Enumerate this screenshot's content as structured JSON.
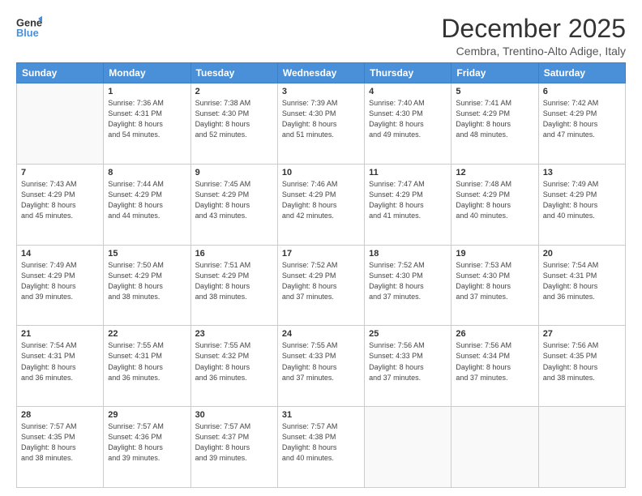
{
  "logo": {
    "line1": "General",
    "line2": "Blue"
  },
  "title": "December 2025",
  "location": "Cembra, Trentino-Alto Adige, Italy",
  "header": {
    "days": [
      "Sunday",
      "Monday",
      "Tuesday",
      "Wednesday",
      "Thursday",
      "Friday",
      "Saturday"
    ]
  },
  "weeks": [
    [
      {
        "day": "",
        "info": ""
      },
      {
        "day": "1",
        "info": "Sunrise: 7:36 AM\nSunset: 4:31 PM\nDaylight: 8 hours\nand 54 minutes."
      },
      {
        "day": "2",
        "info": "Sunrise: 7:38 AM\nSunset: 4:30 PM\nDaylight: 8 hours\nand 52 minutes."
      },
      {
        "day": "3",
        "info": "Sunrise: 7:39 AM\nSunset: 4:30 PM\nDaylight: 8 hours\nand 51 minutes."
      },
      {
        "day": "4",
        "info": "Sunrise: 7:40 AM\nSunset: 4:30 PM\nDaylight: 8 hours\nand 49 minutes."
      },
      {
        "day": "5",
        "info": "Sunrise: 7:41 AM\nSunset: 4:29 PM\nDaylight: 8 hours\nand 48 minutes."
      },
      {
        "day": "6",
        "info": "Sunrise: 7:42 AM\nSunset: 4:29 PM\nDaylight: 8 hours\nand 47 minutes."
      }
    ],
    [
      {
        "day": "7",
        "info": "Sunrise: 7:43 AM\nSunset: 4:29 PM\nDaylight: 8 hours\nand 45 minutes."
      },
      {
        "day": "8",
        "info": "Sunrise: 7:44 AM\nSunset: 4:29 PM\nDaylight: 8 hours\nand 44 minutes."
      },
      {
        "day": "9",
        "info": "Sunrise: 7:45 AM\nSunset: 4:29 PM\nDaylight: 8 hours\nand 43 minutes."
      },
      {
        "day": "10",
        "info": "Sunrise: 7:46 AM\nSunset: 4:29 PM\nDaylight: 8 hours\nand 42 minutes."
      },
      {
        "day": "11",
        "info": "Sunrise: 7:47 AM\nSunset: 4:29 PM\nDaylight: 8 hours\nand 41 minutes."
      },
      {
        "day": "12",
        "info": "Sunrise: 7:48 AM\nSunset: 4:29 PM\nDaylight: 8 hours\nand 40 minutes."
      },
      {
        "day": "13",
        "info": "Sunrise: 7:49 AM\nSunset: 4:29 PM\nDaylight: 8 hours\nand 40 minutes."
      }
    ],
    [
      {
        "day": "14",
        "info": "Sunrise: 7:49 AM\nSunset: 4:29 PM\nDaylight: 8 hours\nand 39 minutes."
      },
      {
        "day": "15",
        "info": "Sunrise: 7:50 AM\nSunset: 4:29 PM\nDaylight: 8 hours\nand 38 minutes."
      },
      {
        "day": "16",
        "info": "Sunrise: 7:51 AM\nSunset: 4:29 PM\nDaylight: 8 hours\nand 38 minutes."
      },
      {
        "day": "17",
        "info": "Sunrise: 7:52 AM\nSunset: 4:29 PM\nDaylight: 8 hours\nand 37 minutes."
      },
      {
        "day": "18",
        "info": "Sunrise: 7:52 AM\nSunset: 4:30 PM\nDaylight: 8 hours\nand 37 minutes."
      },
      {
        "day": "19",
        "info": "Sunrise: 7:53 AM\nSunset: 4:30 PM\nDaylight: 8 hours\nand 37 minutes."
      },
      {
        "day": "20",
        "info": "Sunrise: 7:54 AM\nSunset: 4:31 PM\nDaylight: 8 hours\nand 36 minutes."
      }
    ],
    [
      {
        "day": "21",
        "info": "Sunrise: 7:54 AM\nSunset: 4:31 PM\nDaylight: 8 hours\nand 36 minutes."
      },
      {
        "day": "22",
        "info": "Sunrise: 7:55 AM\nSunset: 4:31 PM\nDaylight: 8 hours\nand 36 minutes."
      },
      {
        "day": "23",
        "info": "Sunrise: 7:55 AM\nSunset: 4:32 PM\nDaylight: 8 hours\nand 36 minutes."
      },
      {
        "day": "24",
        "info": "Sunrise: 7:55 AM\nSunset: 4:33 PM\nDaylight: 8 hours\nand 37 minutes."
      },
      {
        "day": "25",
        "info": "Sunrise: 7:56 AM\nSunset: 4:33 PM\nDaylight: 8 hours\nand 37 minutes."
      },
      {
        "day": "26",
        "info": "Sunrise: 7:56 AM\nSunset: 4:34 PM\nDaylight: 8 hours\nand 37 minutes."
      },
      {
        "day": "27",
        "info": "Sunrise: 7:56 AM\nSunset: 4:35 PM\nDaylight: 8 hours\nand 38 minutes."
      }
    ],
    [
      {
        "day": "28",
        "info": "Sunrise: 7:57 AM\nSunset: 4:35 PM\nDaylight: 8 hours\nand 38 minutes."
      },
      {
        "day": "29",
        "info": "Sunrise: 7:57 AM\nSunset: 4:36 PM\nDaylight: 8 hours\nand 39 minutes."
      },
      {
        "day": "30",
        "info": "Sunrise: 7:57 AM\nSunset: 4:37 PM\nDaylight: 8 hours\nand 39 minutes."
      },
      {
        "day": "31",
        "info": "Sunrise: 7:57 AM\nSunset: 4:38 PM\nDaylight: 8 hours\nand 40 minutes."
      },
      {
        "day": "",
        "info": ""
      },
      {
        "day": "",
        "info": ""
      },
      {
        "day": "",
        "info": ""
      }
    ]
  ]
}
